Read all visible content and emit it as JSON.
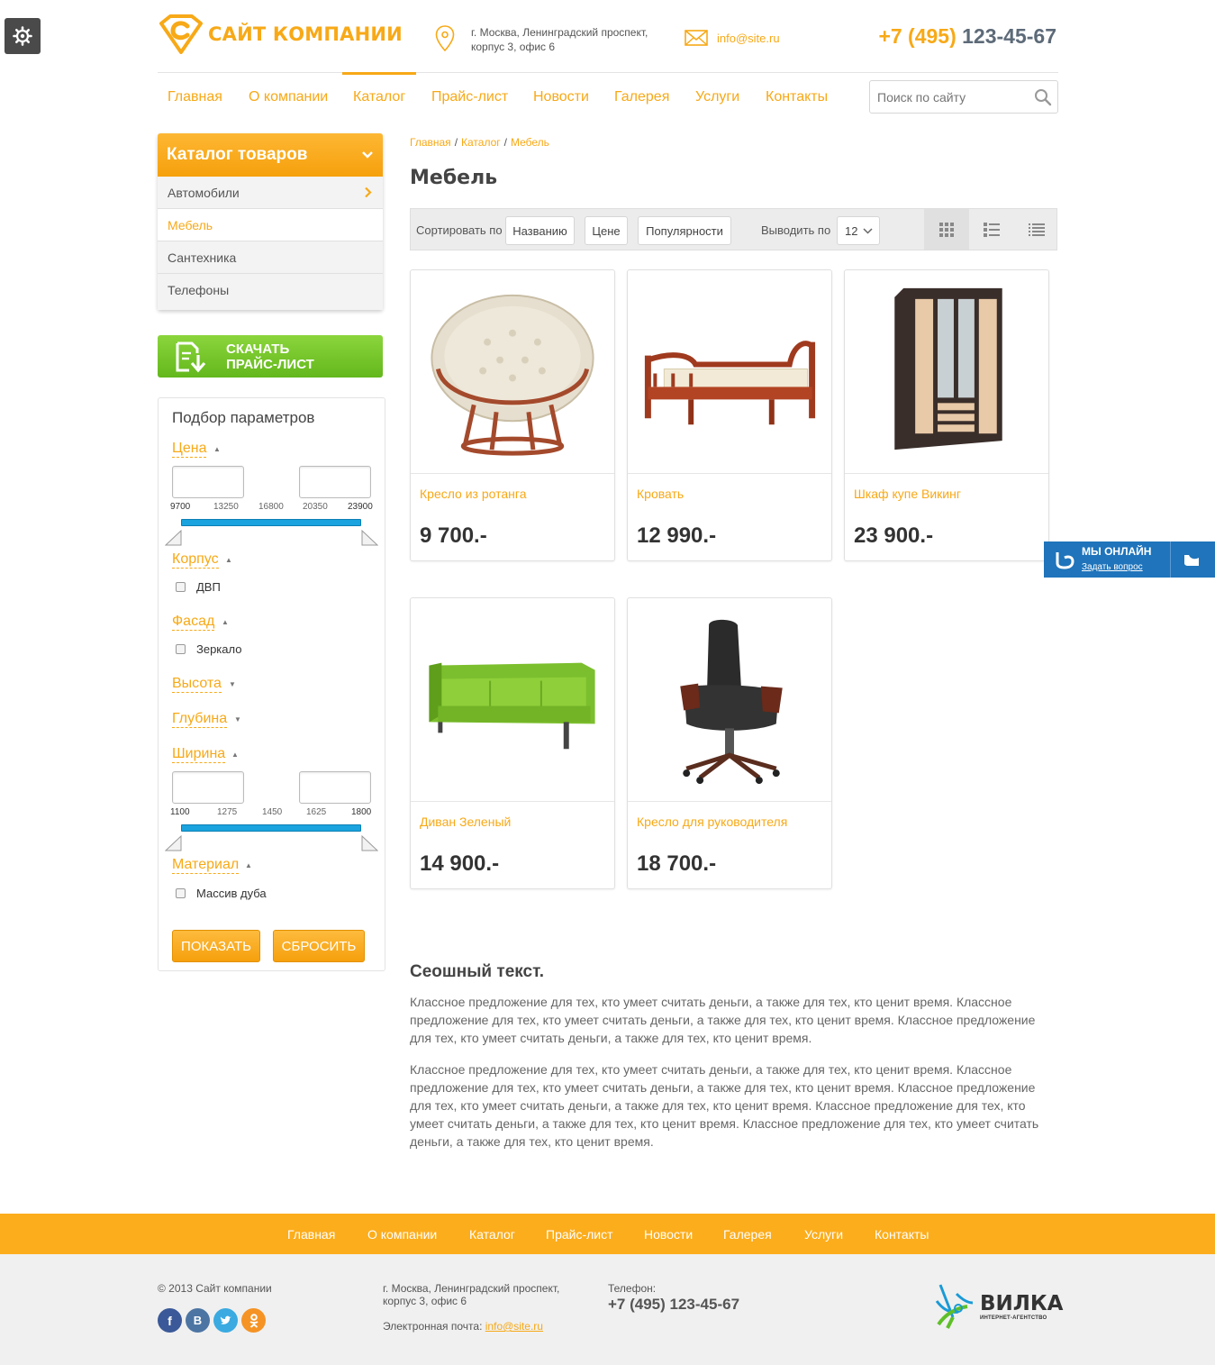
{
  "header": {
    "logo_text": "САЙТ КОМПАНИИ",
    "address": "г. Москва, Ленинградский проспект, корпус 3, офис 6",
    "email": "info@site.ru",
    "phone_code": "+7 (495)",
    "phone_number": "123-45-67"
  },
  "nav": {
    "items": [
      "Главная",
      "О компании",
      "Каталог",
      "Прайс-лист",
      "Новости",
      "Галерея",
      "Услуги",
      "Контакты"
    ],
    "active": "Каталог"
  },
  "search": {
    "placeholder": "Поиск по сайту"
  },
  "catalog": {
    "title": "Каталог товаров",
    "items": [
      "Автомобили",
      "Мебель",
      "Сантехника",
      "Телефоны"
    ],
    "active": "Мебель"
  },
  "download": {
    "line1": "СКАЧАТЬ",
    "line2": "ПРАЙС-ЛИСТ"
  },
  "filter": {
    "title": "Подбор параметров",
    "price": {
      "label": "Цена",
      "ticks": [
        "9700",
        "13250",
        "16800",
        "20350",
        "23900"
      ]
    },
    "body": {
      "label": "Корпус",
      "option": "ДВП"
    },
    "facade": {
      "label": "Фасад",
      "option": "Зеркало"
    },
    "height": {
      "label": "Высота"
    },
    "depth": {
      "label": "Глубина"
    },
    "width": {
      "label": "Ширина",
      "ticks": [
        "1100",
        "1275",
        "1450",
        "1625",
        "1800"
      ]
    },
    "material": {
      "label": "Материал",
      "option": "Массив дуба"
    },
    "show_button": "ПОКАЗАТЬ",
    "reset_button": "СБРОСИТЬ"
  },
  "breadcrumb": [
    "Главная",
    "Каталог",
    "Мебель"
  ],
  "page_title": "Мебель",
  "toolbar": {
    "sort_label": "Сортировать по",
    "sort_options": [
      "Названию",
      "Цене",
      "Популярности"
    ],
    "per_page_label": "Выводить по",
    "per_page_value": "12"
  },
  "products": [
    {
      "name": "Кресло из ротанга",
      "price": "9 700.-"
    },
    {
      "name": "Кровать",
      "price": "12 990.-"
    },
    {
      "name": "Шкаф купе Викинг",
      "price": "23 900.-"
    },
    {
      "name": "Диван Зеленый",
      "price": "14 900.-"
    },
    {
      "name": "Кресло для руководителя",
      "price": "18 700.-"
    }
  ],
  "seo": {
    "title": "Сеошный текст.",
    "p1": "Классное предложение для тех, кто умеет считать деньги, а также для тех, кто ценит время. Классное предложение для тех, кто умеет считать деньги, а также для тех, кто ценит время. Классное предложение для тех, кто умеет считать деньги, а также для тех, кто ценит время.",
    "p2": "Классное предложение для тех, кто умеет считать деньги, а также для тех, кто ценит время. Классное предложение для тех, кто умеет считать деньги, а также для тех, кто ценит время. Классное предложение для тех, кто умеет считать деньги, а также для тех, кто ценит время. Классное предложение для тех, кто умеет считать деньги, а также для тех, кто ценит время. Классное предложение для тех, кто умеет считать деньги, а также для тех, кто ценит время."
  },
  "online": {
    "title": "МЫ ОНЛАЙН",
    "link": "Задать вопрос"
  },
  "footer": {
    "copyright": "© 2013 Сайт компании",
    "address": "г. Москва, Ленинградский проспект, корпус 3, офис 6",
    "email_label": "Электронная почта:",
    "email": "info@site.ru",
    "phone_label": "Телефон:",
    "phone": "+7 (495) 123-45-67",
    "agency_name": "ВИЛКА",
    "agency_sub": "ИНТЕРНЕТ-АГЕНТСТВО",
    "social": [
      "facebook",
      "vkontakte",
      "twitter",
      "odnoklassniki"
    ]
  },
  "colors": {
    "accent": "#f7a917",
    "green": "#6cbf24",
    "blue": "#1aa3de",
    "online": "#1f74bb"
  }
}
